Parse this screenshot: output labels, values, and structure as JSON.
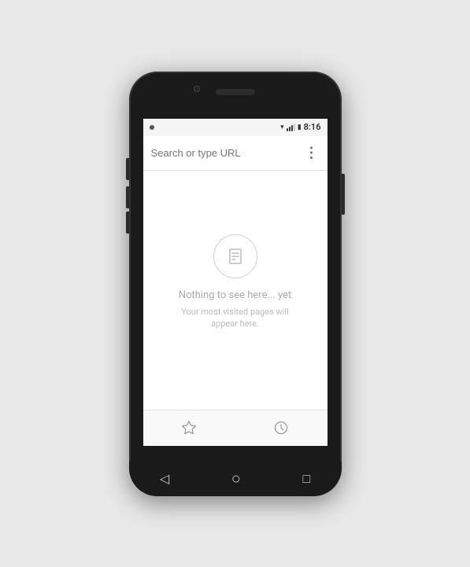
{
  "phone": {
    "status_bar": {
      "left_icon": "notification",
      "time": "8:16",
      "wifi_label": "wifi",
      "signal_label": "signal",
      "battery_label": "battery"
    },
    "url_bar": {
      "placeholder": "Search or type URL",
      "more_icon": "⋮"
    },
    "empty_state": {
      "icon_label": "document-icon",
      "title": "Nothing to see here... yet",
      "subtitle": "Your most visited pages will appear here."
    },
    "bottom_nav": {
      "bookmark_icon": "star-icon",
      "history_icon": "clock-icon"
    },
    "android_nav": {
      "back_label": "◁",
      "home_label": "○",
      "recent_label": "□"
    }
  }
}
